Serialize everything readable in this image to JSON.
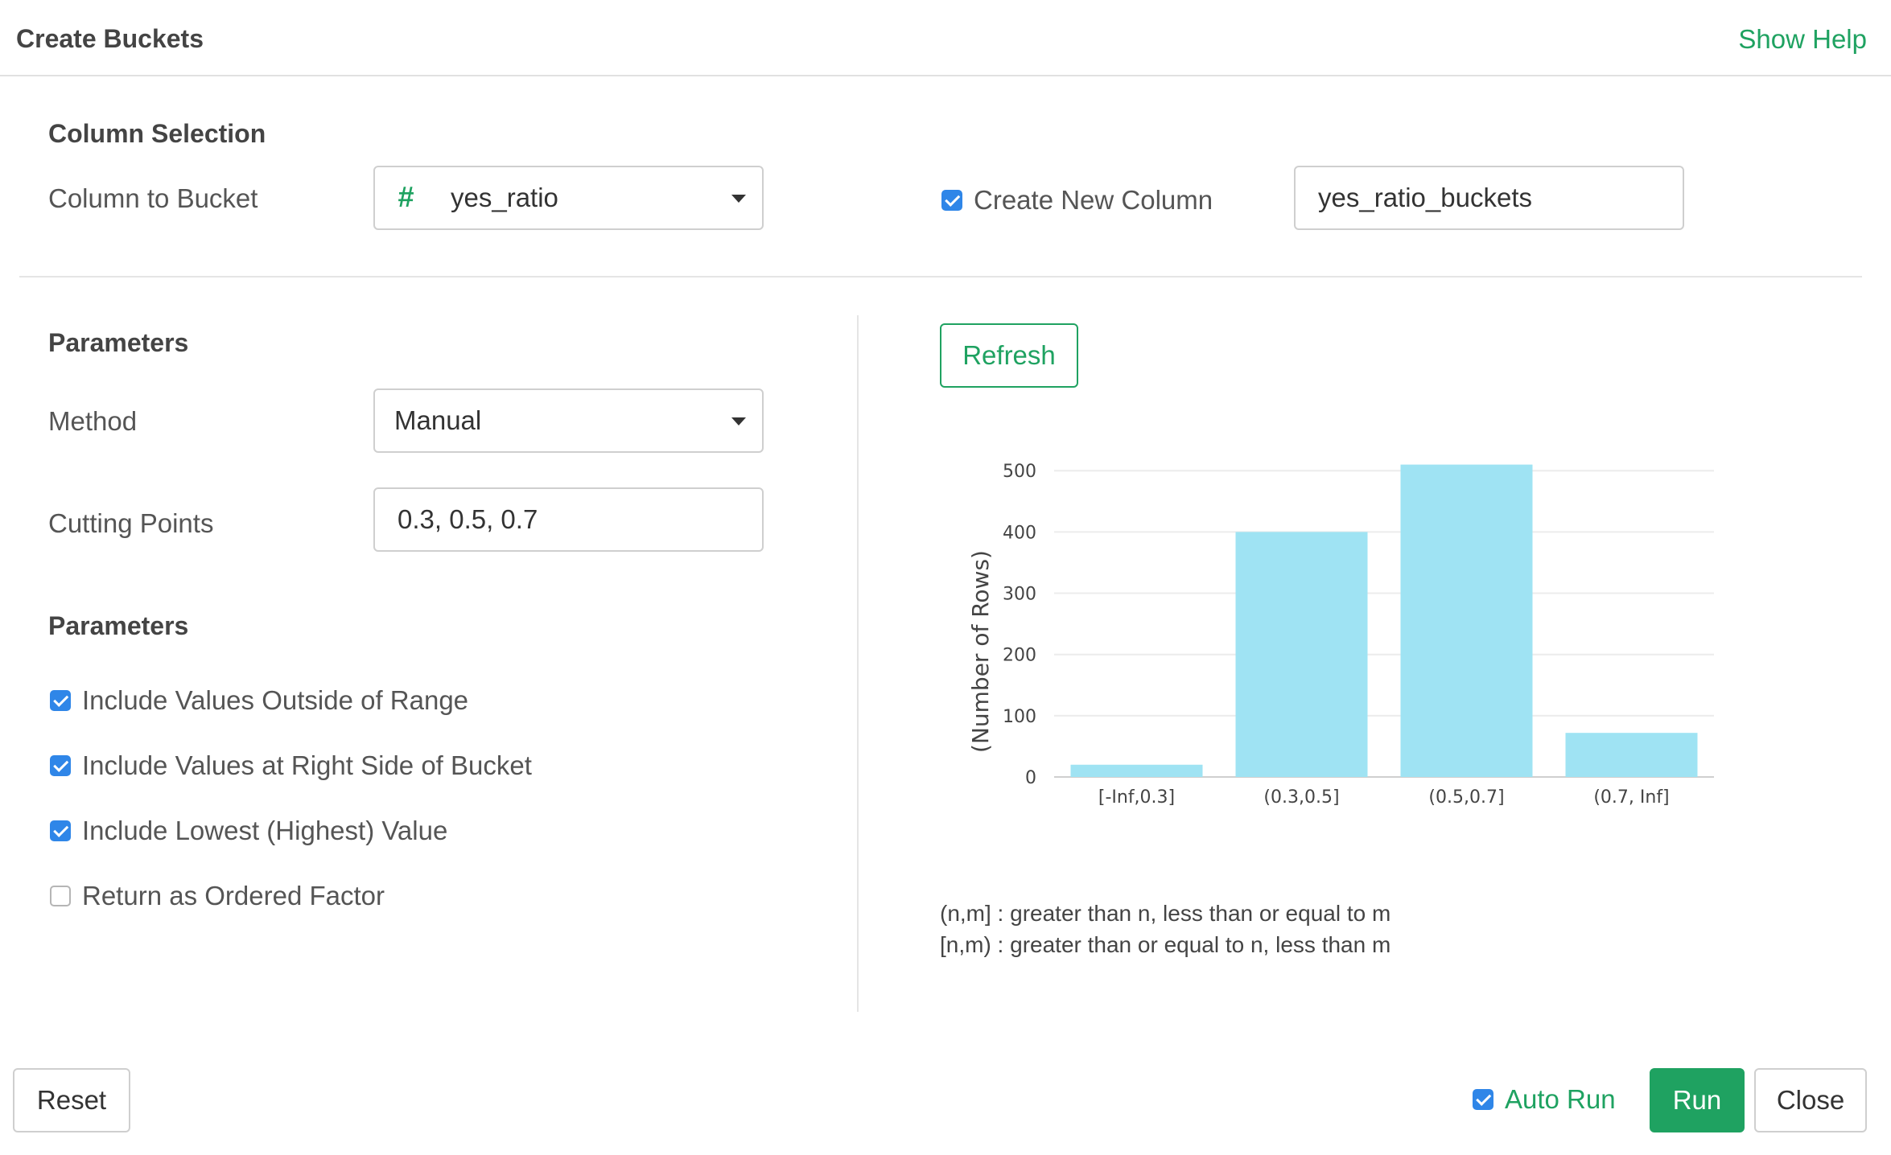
{
  "dialog": {
    "title": "Create Buckets",
    "help_link": "Show Help"
  },
  "column_selection": {
    "heading": "Column Selection",
    "column_label": "Column to Bucket",
    "column_type_icon": "#",
    "column_value": "yes_ratio",
    "create_new_column": {
      "label": "Create New Column",
      "checked": true
    },
    "new_column_name": "yes_ratio_buckets"
  },
  "parameters": {
    "heading": "Parameters",
    "method_label": "Method",
    "method_value": "Manual",
    "cutting_points_label": "Cutting Points",
    "cutting_points_value": "0.3, 0.5, 0.7"
  },
  "options": {
    "heading": "Parameters",
    "items": [
      {
        "label": "Include Values Outside of Range",
        "checked": true
      },
      {
        "label": "Include Values at Right Side of Bucket",
        "checked": true
      },
      {
        "label": "Include Lowest (Highest) Value",
        "checked": true
      },
      {
        "label": "Return as Ordered Factor",
        "checked": false
      }
    ]
  },
  "preview": {
    "refresh_label": "Refresh",
    "legend": [
      "(n,m] : greater than n, less than or equal to m",
      "[n,m) : greater than or equal to n, less than m"
    ]
  },
  "chart_data": {
    "type": "bar",
    "categories": [
      "[-Inf,0.3]",
      "(0.3,0.5]",
      "(0.5,0.7]",
      "(0.7, Inf]"
    ],
    "values": [
      20,
      400,
      510,
      72
    ],
    "ylabel": "(Number of Rows)",
    "xlabel": "",
    "yticks": [
      0,
      100,
      200,
      300,
      400,
      500
    ],
    "ylim": [
      0,
      520
    ],
    "grid": true,
    "bar_color": "#9fe3f3"
  },
  "footer": {
    "reset_label": "Reset",
    "auto_run": {
      "label": "Auto Run",
      "checked": true
    },
    "run_label": "Run",
    "close_label": "Close"
  },
  "colors": {
    "accent": "#1fa261",
    "checkbox": "#2f86e8"
  }
}
